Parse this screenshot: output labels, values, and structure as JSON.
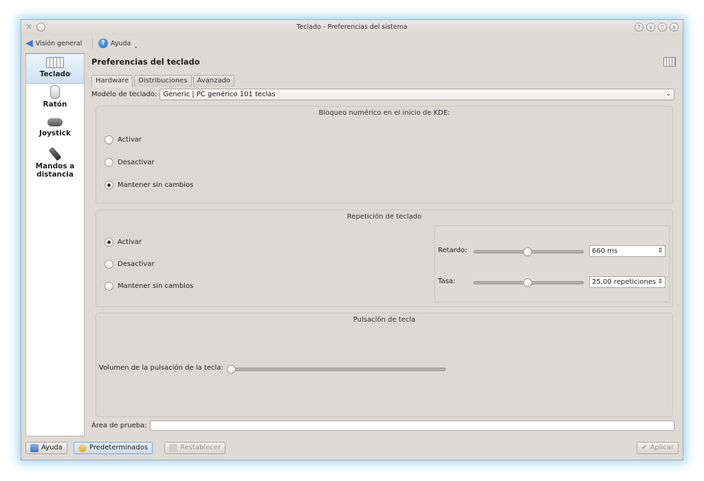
{
  "window": {
    "title": "Teclado - Preferencias del sistema",
    "controls": [
      "?",
      "v",
      "^",
      "x"
    ]
  },
  "toolbar": {
    "overview_label": "Visión general",
    "help_label": "Ayuda"
  },
  "sidebar": {
    "items": [
      {
        "label": "Teclado",
        "icon": "keyboard-icon",
        "selected": true
      },
      {
        "label": "Ratón",
        "icon": "mouse-icon"
      },
      {
        "label": "Joystick",
        "icon": "joystick-icon"
      },
      {
        "label": "Mandos a distancia",
        "icon": "remote-icon"
      }
    ]
  },
  "content": {
    "heading": "Preferencias del teclado",
    "tabs": [
      "Hardware",
      "Distribuciones",
      "Avanzado"
    ],
    "model_label": "Modelo de teclado:",
    "model_value": "Generic | PC genérico 101 teclas",
    "numlock": {
      "title": "Bloqueo numérico en el inicio de KDE:",
      "options": [
        "Activar",
        "Desactivar",
        "Mantener sin cambios"
      ],
      "selected": 2
    },
    "repeat": {
      "title": "Repetición de teclado",
      "options": [
        "Activar",
        "Desactivar",
        "Mantener sin cambios"
      ],
      "selected": 0,
      "delay_label": "Retardo:",
      "delay_value": "660 ms",
      "delay_level": 0.5,
      "rate_label": "Tasa:",
      "rate_value": "25,00 repeticiones",
      "rate_level": 0.5
    },
    "click": {
      "title": "Pulsación de tecla",
      "volume_label": "Volumen de la pulsación de la tecla:",
      "volume_level": 0
    },
    "test_label": "Área de prueba:"
  },
  "buttons": {
    "help": "Ayuda",
    "defaults": "Predeterminados",
    "reset": "Restablecer",
    "apply": "Aplicar"
  }
}
